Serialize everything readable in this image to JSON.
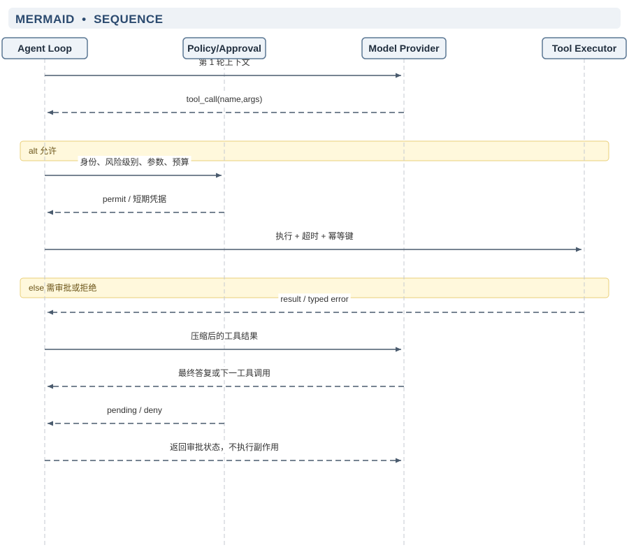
{
  "header": {
    "label": "MERMAID",
    "separator": "•",
    "kind": "SEQUENCE"
  },
  "colors": {
    "actor_fill": "#eef3f8",
    "actor_stroke": "#5c7894",
    "lifeline": "#c4cad1",
    "arrow": "#4a5b6e",
    "frame_fill": "#fff8dc",
    "frame_stroke": "#e9cf7a",
    "header_bg": "#eef2f6",
    "header_text": "#2b4a6f"
  },
  "actors": [
    {
      "id": "agent",
      "name": "Agent Loop"
    },
    {
      "id": "policy",
      "name": "Policy/Approval"
    },
    {
      "id": "model",
      "name": "Model Provider"
    },
    {
      "id": "tool",
      "name": "Tool Executor"
    }
  ],
  "frames": [
    {
      "label": "alt 允许"
    },
    {
      "label": "else 需审批或拒绝"
    }
  ],
  "messages": [
    {
      "from": "agent",
      "to": "model",
      "label": "第 1 轮上下文",
      "style": "solid"
    },
    {
      "from": "model",
      "to": "agent",
      "label": "tool_call(name,args)",
      "style": "dashed"
    },
    {
      "from": "agent",
      "to": "policy",
      "label": "身份、风险级别、参数、预算",
      "style": "solid"
    },
    {
      "from": "policy",
      "to": "agent",
      "label": "permit / 短期凭据",
      "style": "dashed"
    },
    {
      "from": "agent",
      "to": "tool",
      "label": "执行 + 超时 + 幂等键",
      "style": "solid"
    },
    {
      "from": "tool",
      "to": "agent",
      "label": "result / typed error",
      "style": "dashed"
    },
    {
      "from": "agent",
      "to": "model",
      "label": "压缩后的工具结果",
      "style": "solid"
    },
    {
      "from": "model",
      "to": "agent",
      "label": "最终答复或下一工具调用",
      "style": "dashed"
    },
    {
      "from": "policy",
      "to": "agent",
      "label": "pending / deny",
      "style": "dashed"
    },
    {
      "from": "agent",
      "to": "model",
      "label": "返回审批状态，不执行副作用",
      "style": "dashed"
    }
  ]
}
